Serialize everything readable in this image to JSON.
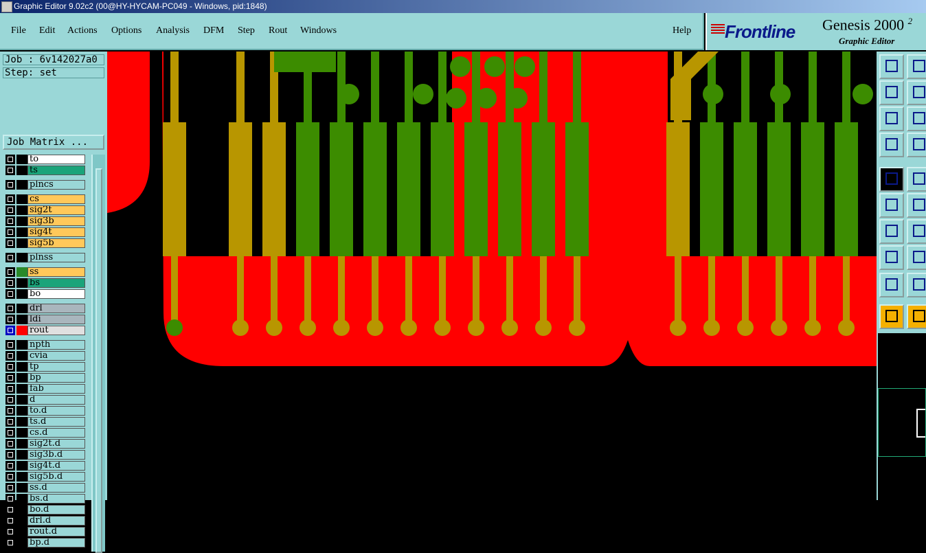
{
  "window": {
    "title": "Graphic Editor 9.02c2 (00@HY-HYCAM-PC049 - Windows, pid:1848)"
  },
  "menu": {
    "items": [
      "File",
      "Edit",
      "Actions",
      "Options",
      "Analysis",
      "DFM",
      "Step",
      "Rout",
      "Windows"
    ],
    "help": "Help"
  },
  "brand": {
    "logo": "Frontline",
    "product": "Genesis 2000",
    "version_mark": "2",
    "subtitle": "Graphic Editor"
  },
  "job": {
    "label": "Job : 6v142027a0",
    "step": "Step: set",
    "matrix_button": "Job Matrix ..."
  },
  "layers": [
    {
      "name": "to",
      "color": "#ffffff",
      "swatch": "#000"
    },
    {
      "name": "ts",
      "color": "#1aa47a",
      "swatch": "#000"
    },
    {
      "name": "plncs",
      "color": "#9ad7d7",
      "swatch": "#000",
      "gap": true
    },
    {
      "name": "cs",
      "color": "#ffc85a",
      "swatch": "#000",
      "gap": true
    },
    {
      "name": "sig2t",
      "color": "#ffc85a",
      "swatch": "#000"
    },
    {
      "name": "sig3b",
      "color": "#ffc85a",
      "swatch": "#000"
    },
    {
      "name": "sig4t",
      "color": "#ffc85a",
      "swatch": "#000"
    },
    {
      "name": "sig5b",
      "color": "#ffc85a",
      "swatch": "#000"
    },
    {
      "name": "plnss",
      "color": "#9ad7d7",
      "swatch": "#000",
      "gap": true
    },
    {
      "name": "ss",
      "color": "#ffc85a",
      "swatch": "#2a8a2a",
      "gap": true
    },
    {
      "name": "bs",
      "color": "#1aa47a",
      "swatch": "#000"
    },
    {
      "name": "bo",
      "color": "#ffffff",
      "swatch": "#000"
    },
    {
      "name": "drl",
      "color": "#a9b6bd",
      "swatch": "#000",
      "gap": true
    },
    {
      "name": "ldi",
      "color": "#a9b6bd",
      "swatch": "#000"
    },
    {
      "name": "rout",
      "color": "#e0e0e0",
      "swatch": "#ff0000",
      "active": true
    },
    {
      "name": "npth",
      "color": "#9ad7d7",
      "swatch": "#000",
      "gap": true
    },
    {
      "name": "cvia",
      "color": "#9ad7d7",
      "swatch": "#000"
    },
    {
      "name": "tp",
      "color": "#9ad7d7",
      "swatch": "#000"
    },
    {
      "name": "bp",
      "color": "#9ad7d7",
      "swatch": "#000"
    },
    {
      "name": "fab",
      "color": "#9ad7d7",
      "swatch": "#000"
    },
    {
      "name": "d",
      "color": "#9ad7d7",
      "swatch": "#000"
    },
    {
      "name": "to.d",
      "color": "#9ad7d7",
      "swatch": "#000"
    },
    {
      "name": "ts.d",
      "color": "#9ad7d7",
      "swatch": "#000"
    },
    {
      "name": "cs.d",
      "color": "#9ad7d7",
      "swatch": "#000"
    },
    {
      "name": "sig2t.d",
      "color": "#9ad7d7",
      "swatch": "#000"
    },
    {
      "name": "sig3b.d",
      "color": "#9ad7d7",
      "swatch": "#000"
    },
    {
      "name": "sig4t.d",
      "color": "#9ad7d7",
      "swatch": "#000"
    },
    {
      "name": "sig5b.d",
      "color": "#9ad7d7",
      "swatch": "#000"
    },
    {
      "name": "ss.d",
      "color": "#9ad7d7",
      "swatch": "#000"
    },
    {
      "name": "bs.d",
      "color": "#9ad7d7",
      "swatch": "#000"
    },
    {
      "name": "bo.d",
      "color": "#9ad7d7",
      "swatch": "#000"
    },
    {
      "name": "drl.d",
      "color": "#9ad7d7",
      "swatch": "#000"
    },
    {
      "name": "rout.d",
      "color": "#9ad7d7",
      "swatch": "#000"
    },
    {
      "name": "bp.d",
      "color": "#9ad7d7",
      "swatch": "#000"
    }
  ],
  "colors": {
    "copper_red": "#ff0000",
    "green": "#3c8c00",
    "olive": "#b89600",
    "background": "#000000"
  },
  "toolbar_icons": [
    "zoom-window-icon",
    "pan-icon",
    "zoom-out-icon",
    "zoom-in-icon",
    "fit-icon",
    "fit-all-icon",
    "measure-icon",
    "snap-icon",
    "select-feature-icon",
    "polygon-icon",
    "net-icon",
    "cross-icon",
    "line-icon",
    "arc-icon",
    "pad-icon",
    "move-icon",
    "fill-icon",
    "outline-icon",
    "pointer-icon",
    "select-pointer-icon"
  ]
}
